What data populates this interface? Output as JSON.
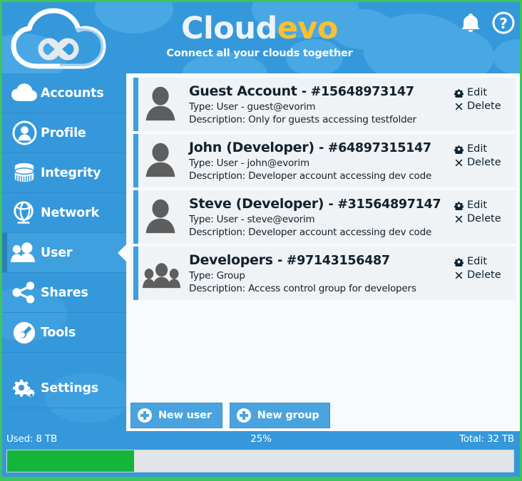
{
  "header": {
    "brand_part1": "Cloud",
    "brand_part2": "evo",
    "tagline": "Connect all your clouds together",
    "bell_icon": "bell-icon",
    "help_icon": "help-icon",
    "brand_color_primary": "#eef3f6",
    "brand_color_accent": "#fbc02d",
    "background_color": "#3498db"
  },
  "sidebar": {
    "items": [
      {
        "label": "Accounts",
        "icon": "cloud-icon",
        "active": false
      },
      {
        "label": "Profile",
        "icon": "user-circle-icon",
        "active": false
      },
      {
        "label": "Integrity",
        "icon": "database-icon",
        "active": false
      },
      {
        "label": "Network",
        "icon": "globe-icon",
        "active": false
      },
      {
        "label": "User",
        "icon": "users-icon",
        "active": true
      },
      {
        "label": "Shares",
        "icon": "share-icon",
        "active": false
      },
      {
        "label": "Tools",
        "icon": "wrench-icon",
        "active": false
      },
      {
        "label": "Settings",
        "icon": "gears-icon",
        "active": false
      }
    ]
  },
  "main": {
    "rows": [
      {
        "name": "Guest Account",
        "id": "- #15648973147",
        "type": "Type: User - guest@evorim",
        "description": "Description: Only for guests accessing testfolder",
        "avatar": "single-person-icon",
        "edit_label": "Edit",
        "delete_label": "Delete"
      },
      {
        "name": "John (Developer)",
        "id": "- #64897315147",
        "type": "Type: User - john@evorim",
        "description": "Description: Developer account accessing dev code",
        "avatar": "single-person-icon",
        "edit_label": "Edit",
        "delete_label": "Delete"
      },
      {
        "name": "Steve (Developer)",
        "id": "- #31564897147",
        "type": "Type: User - steve@evorim",
        "description": "Description: Developer account accessing dev code",
        "avatar": "single-person-icon",
        "edit_label": "Edit",
        "delete_label": "Delete"
      },
      {
        "name": "Developers",
        "id": "- #97143156487",
        "type": "Type: Group",
        "description": "Description: Access control group for developers",
        "avatar": "group-people-icon",
        "edit_label": "Edit",
        "delete_label": "Delete"
      }
    ],
    "buttons": [
      {
        "label": "New user",
        "icon": "plus-circle-icon"
      },
      {
        "label": "New group",
        "icon": "plus-circle-icon"
      }
    ]
  },
  "statusbar": {
    "used": "Used: 8 TB",
    "percent_label": "25%",
    "total": "Total: 32 TB",
    "percent_value": 25,
    "fill_color": "#14b53a",
    "track_color": "#e2e5e7"
  }
}
